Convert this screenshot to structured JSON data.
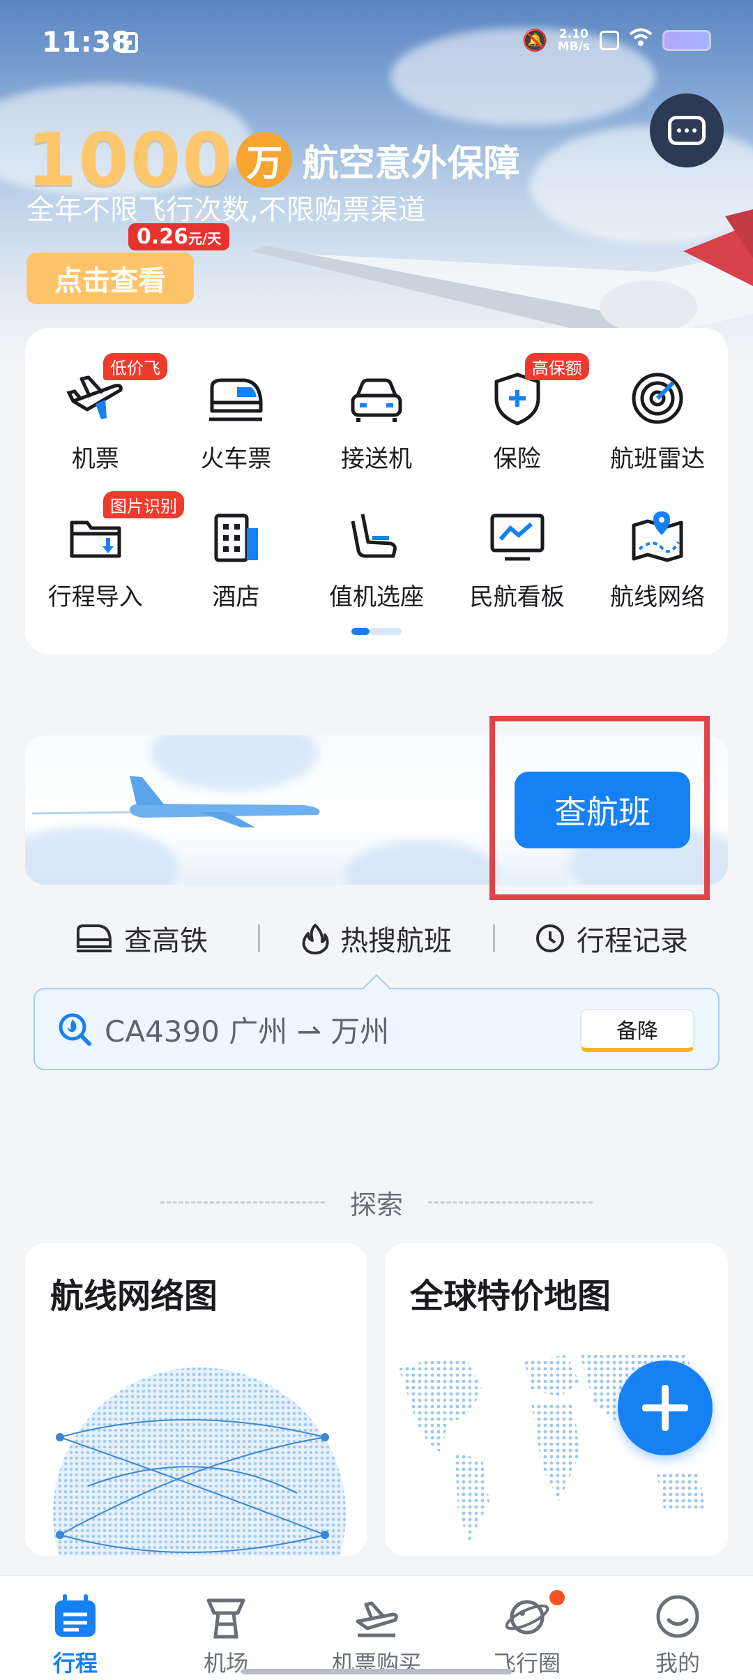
{
  "status_bar": {
    "time": "11:38",
    "net_speed_value": "2.10",
    "net_speed_unit": "MB/s"
  },
  "promo": {
    "amount": "1000",
    "amount_unit": "万",
    "title": "航空意外保障",
    "subtitle": "全年不限飞行次数,不限购票渠道",
    "price": "0.26",
    "price_unit": "元/天",
    "cta": "点击查看"
  },
  "services": [
    {
      "label": "机票",
      "badge": "低价飞",
      "icon": "plane-icon"
    },
    {
      "label": "火车票",
      "badge": "",
      "icon": "train-icon"
    },
    {
      "label": "接送机",
      "badge": "",
      "icon": "car-icon"
    },
    {
      "label": "保险",
      "badge": "高保额",
      "icon": "shield-plus-icon"
    },
    {
      "label": "航班雷达",
      "badge": "",
      "icon": "radar-icon"
    },
    {
      "label": "行程导入",
      "badge": "图片识别",
      "icon": "folder-import-icon"
    },
    {
      "label": "酒店",
      "badge": "",
      "icon": "hotel-icon"
    },
    {
      "label": "值机选座",
      "badge": "",
      "icon": "seat-icon"
    },
    {
      "label": "民航看板",
      "badge": "",
      "icon": "monitor-chart-icon"
    },
    {
      "label": "航线网络",
      "badge": "",
      "icon": "map-pin-icon"
    }
  ],
  "search": {
    "button": "查航班"
  },
  "quick_links": [
    {
      "label": "查高铁",
      "icon": "train-outline-icon"
    },
    {
      "label": "热搜航班",
      "icon": "flame-icon"
    },
    {
      "label": "行程记录",
      "icon": "clock-icon"
    }
  ],
  "hot_flight": {
    "text": "CA4390 广州 ⇀ 万州",
    "tag": "备降"
  },
  "explore": {
    "title": "探索",
    "cards": [
      {
        "title": "航线网络图"
      },
      {
        "title": "全球特价地图"
      }
    ]
  },
  "bottom_nav": [
    {
      "label": "行程",
      "active": true
    },
    {
      "label": "机场",
      "active": false
    },
    {
      "label": "机票购买",
      "active": false
    },
    {
      "label": "飞行圈",
      "active": false
    },
    {
      "label": "我的",
      "active": false
    }
  ],
  "colors": {
    "accent": "#1681f4",
    "badge_red": "#ef3b2e",
    "highlight": "#e24446",
    "gold": "#ffc76b"
  }
}
